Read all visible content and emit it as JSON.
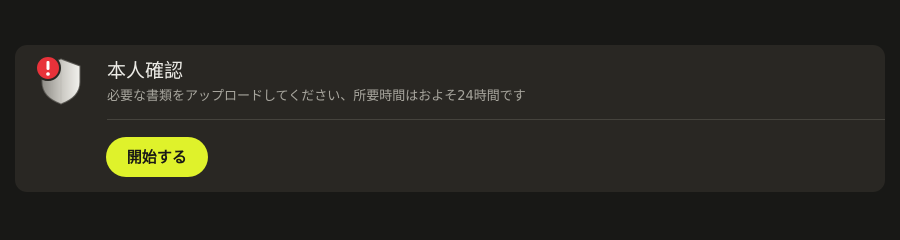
{
  "verification": {
    "title": "本人確認",
    "description": "必要な書類をアップロードしてください、所要時間はおよそ24時間です",
    "start_button_label": "開始する",
    "status_icon": "shield-icon",
    "alert_icon": "exclamation-alert-icon"
  },
  "colors": {
    "background": "#181816",
    "card": "#292723",
    "accent": "#dff22b",
    "alert": "#e8323a"
  }
}
